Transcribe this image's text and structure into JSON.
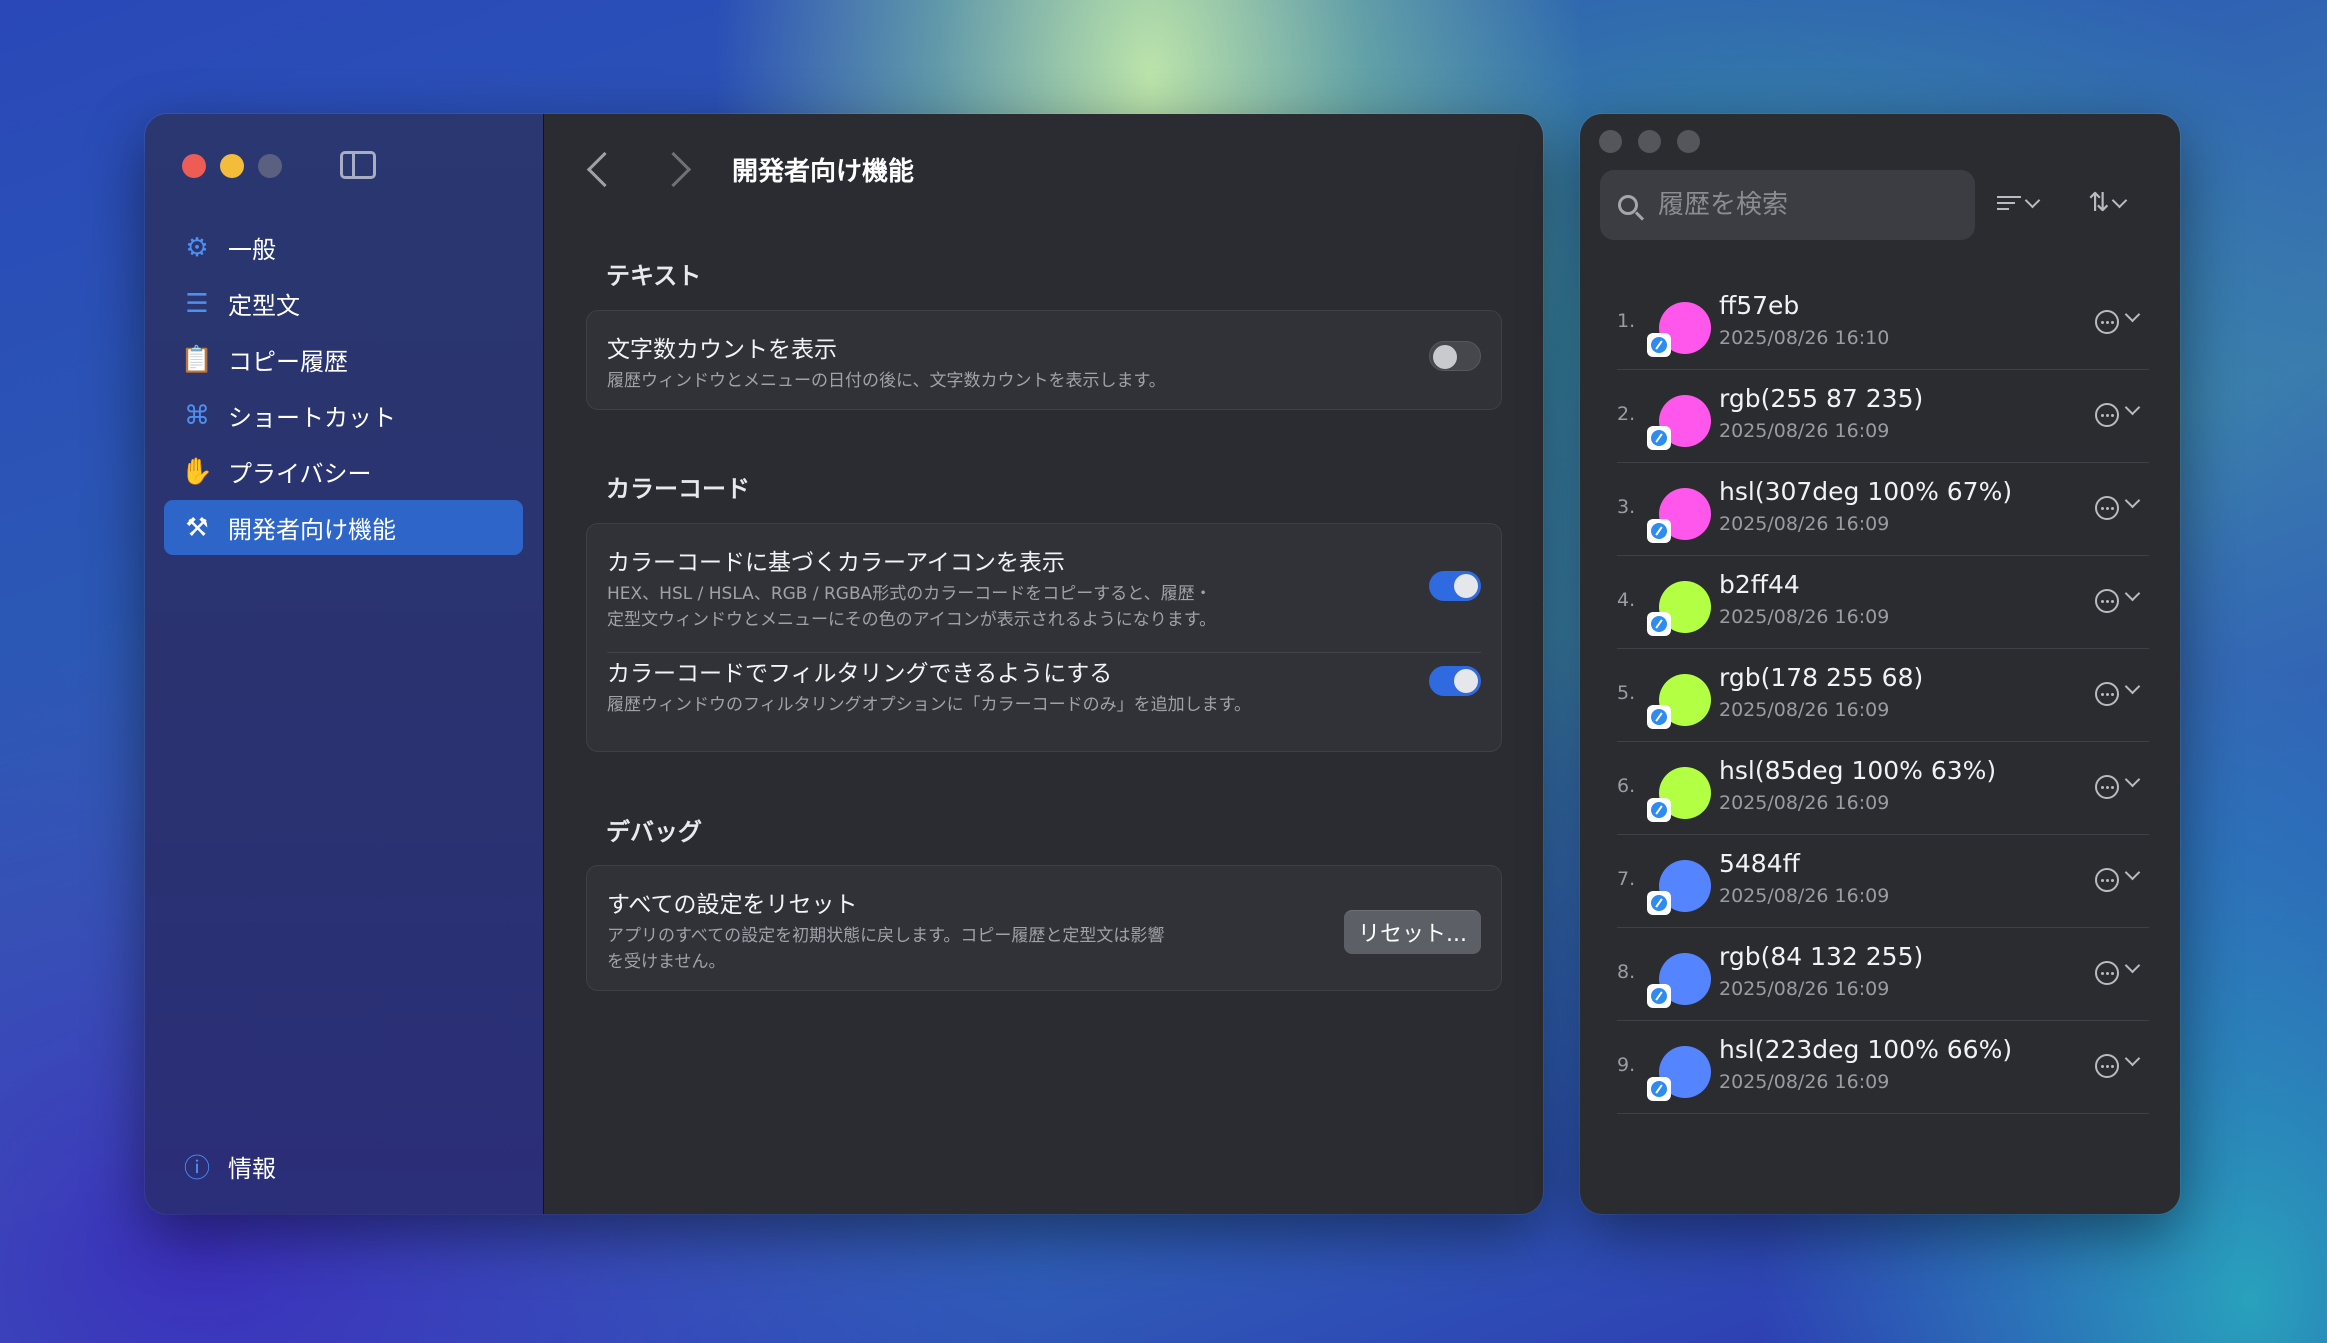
{
  "settings": {
    "sidebar": {
      "items": [
        {
          "label": "一般",
          "icon": "gear-icon"
        },
        {
          "label": "定型文",
          "icon": "list-icon"
        },
        {
          "label": "コピー履歴",
          "icon": "clipboard-icon"
        },
        {
          "label": "ショートカット",
          "icon": "command-icon"
        },
        {
          "label": "プライバシー",
          "icon": "hand-icon"
        },
        {
          "label": "開発者向け機能",
          "icon": "hammer-icon",
          "active": true
        }
      ],
      "footer": {
        "label": "情報",
        "icon": "info-icon"
      }
    },
    "page_title": "開発者向け機能",
    "sections": [
      {
        "title": "テキスト",
        "rows": [
          {
            "title": "文字数カウントを表示",
            "desc": "履歴ウィンドウとメニューの日付の後に、文字数カウントを表示します。",
            "toggle": false
          }
        ]
      },
      {
        "title": "カラーコード",
        "rows": [
          {
            "title": "カラーコードに基づくカラーアイコンを表示",
            "desc_line1": "HEX、HSL / HSLA、RGB / RGBA形式のカラーコードをコピーすると、履歴・",
            "desc_line2": "定型文ウィンドウとメニューにその色のアイコンが表示されるようになります。",
            "toggle": true
          },
          {
            "title": "カラーコードでフィルタリングできるようにする",
            "desc": "履歴ウィンドウのフィルタリングオプションに「カラーコードのみ」を追加します。",
            "toggle": true
          }
        ]
      },
      {
        "title": "デバッグ",
        "rows": [
          {
            "title": "すべての設定をリセット",
            "desc_line1": "アプリのすべての設定を初期状態に戻します。コピー履歴と定型文は影響",
            "desc_line2": "を受けません。",
            "button": "リセット..."
          }
        ]
      }
    ]
  },
  "history": {
    "search_placeholder": "履歴を検索",
    "items": [
      {
        "num": "1.",
        "title": "ff57eb",
        "date": "2025/08/26 16:10",
        "color": "#ff57eb"
      },
      {
        "num": "2.",
        "title": "rgb(255 87 235)",
        "date": "2025/08/26 16:09",
        "color": "#ff57eb"
      },
      {
        "num": "3.",
        "title": "hsl(307deg 100% 67%)",
        "date": "2025/08/26 16:09",
        "color": "#ff57eb"
      },
      {
        "num": "4.",
        "title": "b2ff44",
        "date": "2025/08/26 16:09",
        "color": "#b2ff44"
      },
      {
        "num": "5.",
        "title": "rgb(178 255 68)",
        "date": "2025/08/26 16:09",
        "color": "#b2ff44"
      },
      {
        "num": "6.",
        "title": "hsl(85deg 100% 63%)",
        "date": "2025/08/26 16:09",
        "color": "#b2ff44"
      },
      {
        "num": "7.",
        "title": "5484ff",
        "date": "2025/08/26 16:09",
        "color": "#5484ff"
      },
      {
        "num": "8.",
        "title": "rgb(84 132 255)",
        "date": "2025/08/26 16:09",
        "color": "#5484ff"
      },
      {
        "num": "9.",
        "title": "hsl(223deg 100% 66%)",
        "date": "2025/08/26 16:09",
        "color": "#5484ff"
      }
    ]
  }
}
